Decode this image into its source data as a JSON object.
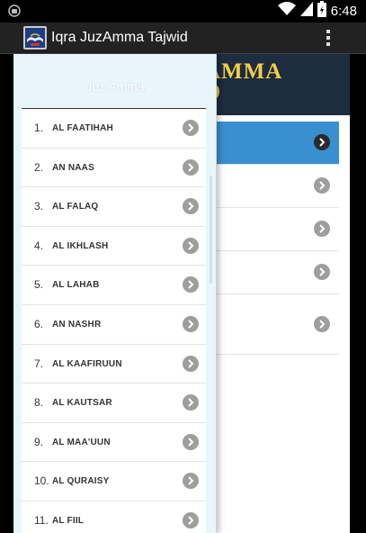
{
  "status_bar": {
    "time": "6:48",
    "left_icon": "android-notification-icon",
    "icons": [
      "wifi-icon",
      "signal-icon",
      "battery-icon"
    ]
  },
  "action_bar": {
    "title": "Iqra JuzAmma Tajwid",
    "app_icon": "quran-book-icon",
    "overflow_icon": "overflow-menu-icon"
  },
  "background_content": {
    "banner_text": "AMMA\nD",
    "colors": {
      "banner_bg": "#1d2c3f",
      "banner_text": "#f2ce45",
      "highlight": "#3a8fd0"
    }
  },
  "drawer": {
    "header": "Juz Amma",
    "items": [
      {
        "num": "1.",
        "name": "AL FAATIHAH"
      },
      {
        "num": "2.",
        "name": "AN NAAS"
      },
      {
        "num": "3.",
        "name": "AL FALAQ"
      },
      {
        "num": "4.",
        "name": "AL IKHLASH"
      },
      {
        "num": "5.",
        "name": "AL LAHAB"
      },
      {
        "num": "6.",
        "name": "AN NASHR"
      },
      {
        "num": "7.",
        "name": "AL KAAFIRUUN"
      },
      {
        "num": "8.",
        "name": "AL KAUTSAR"
      },
      {
        "num": "9.",
        "name": "AL MAA'UUN"
      },
      {
        "num": "10.",
        "name": "AL QURAISY"
      },
      {
        "num": "11.",
        "name": "AL FIIL"
      }
    ],
    "colors": {
      "drawer_bg": "#e8f6fb",
      "chevron": "#9e9e9e"
    }
  }
}
